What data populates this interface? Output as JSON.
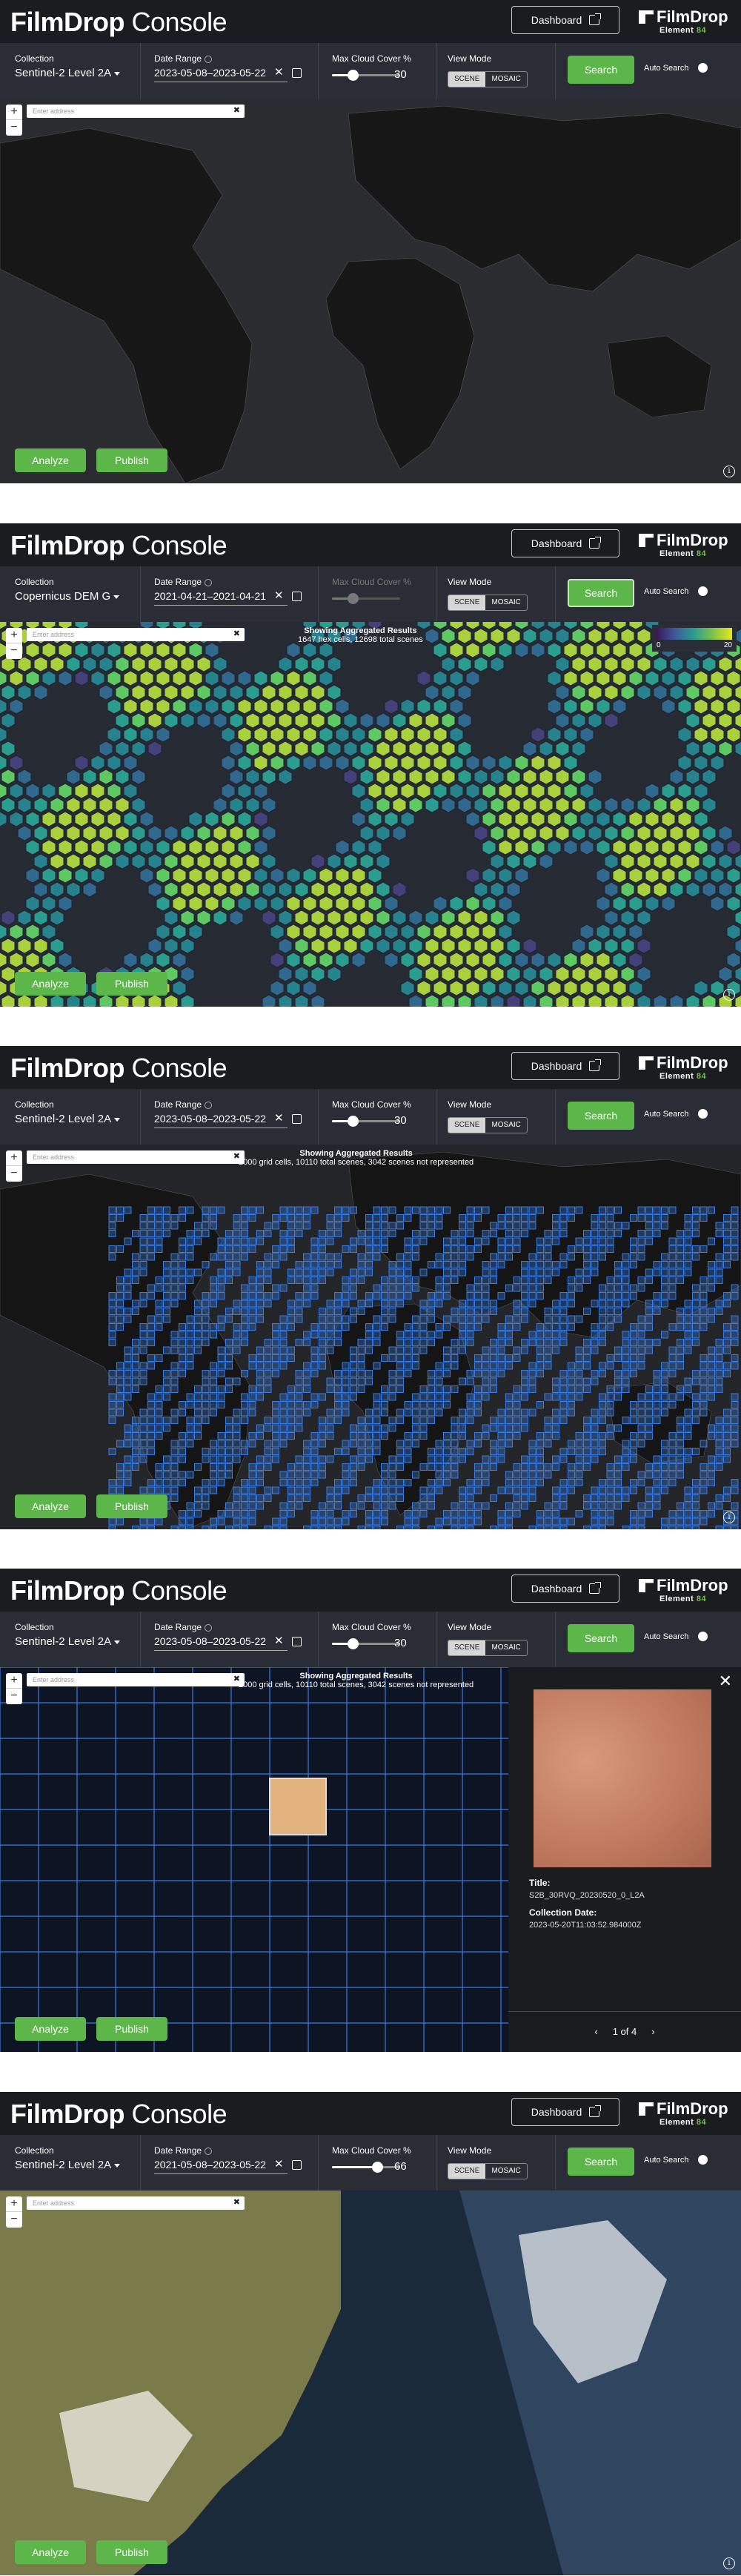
{
  "app": {
    "title_bold": "FilmDrop",
    "title_light": " Console",
    "dashboard_label": "Dashboard",
    "brand_name": "FilmDrop",
    "brand_sub_a": "Element ",
    "brand_sub_b": "84"
  },
  "labels": {
    "collection": "Collection",
    "date_range": "Date Range",
    "max_cloud": "Max Cloud Cover %",
    "view_mode": "View Mode",
    "scene": "SCENE",
    "mosaic": "MOSAIC",
    "search": "Search",
    "auto_search": "Auto Search",
    "address_placeholder": "Enter address",
    "analyze": "Analyze",
    "publish": "Publish",
    "zoom_in": "+",
    "zoom_out": "−"
  },
  "screens": [
    {
      "collection": "Sentinel-2 Level 2A",
      "date_range": "2023-05-08–2023-05-22",
      "cloud": "30",
      "cloud_level": 0.3
    },
    {
      "collection": "Copernicus DEM G",
      "date_range": "2021-04-21–2021-04-21",
      "cloud": "",
      "cloud_level": 0.3,
      "agg_title": "Showing Aggregated Results",
      "agg_detail": "1647 hex cells, 12698 total scenes",
      "legend_min": "0",
      "legend_max": "20"
    },
    {
      "collection": "Sentinel-2 Level 2A",
      "date_range": "2023-05-08–2023-05-22",
      "cloud": "30",
      "cloud_level": 0.3,
      "agg_title": "Showing Aggregated Results",
      "agg_detail": "2000 grid cells, 10110 total scenes, 3042 scenes not represented"
    },
    {
      "collection": "Sentinel-2 Level 2A",
      "date_range": "2023-05-08–2023-05-22",
      "cloud": "30",
      "cloud_level": 0.3,
      "agg_title": "Showing Aggregated Results",
      "agg_detail": "2000 grid cells, 10110 total scenes, 3042 scenes not represented",
      "detail_title_label": "Title:",
      "detail_title": "S2B_30RVQ_20230520_0_L2A",
      "detail_date_label": "Collection Date:",
      "detail_date": "2023-05-20T11:03:52.984000Z",
      "pager": "1 of 4",
      "pager_prev": "‹",
      "pager_next": "›",
      "close": "✕"
    },
    {
      "collection": "Sentinel-2 Level 2A",
      "date_range": "2021-05-08–2023-05-22",
      "cloud": "66",
      "cloud_level": 0.66
    }
  ],
  "colors": {
    "accent_green": "#5cb64a",
    "header_bg": "#1b1c20",
    "filter_bg": "#2a2d36",
    "grid_blue": "#3a7be0"
  }
}
